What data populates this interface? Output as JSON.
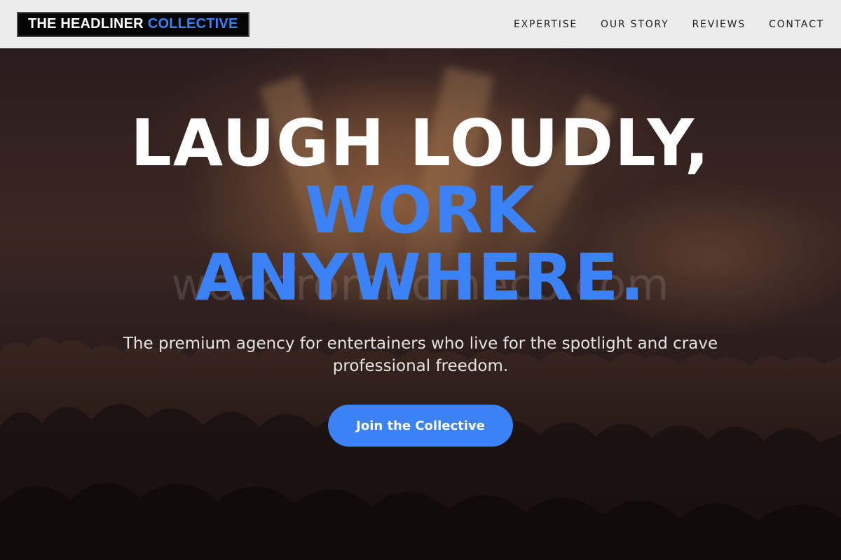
{
  "header": {
    "logo_primary": "THE HEADLINER",
    "logo_accent": "COLLECTIVE",
    "nav": [
      {
        "label": "EXPERTISE"
      },
      {
        "label": "OUR STORY"
      },
      {
        "label": "REVIEWS"
      },
      {
        "label": "CONTACT"
      }
    ]
  },
  "hero": {
    "headline_line1": "LAUGH LOUDLY,",
    "headline_line2": "WORK",
    "headline_line3": "ANYWHERE.",
    "subtitle": "The premium agency for entertainers who live for the spotlight and crave professional freedom.",
    "cta_label": "Join the Collective",
    "watermark": "workfromhomeco.com"
  },
  "colors": {
    "accent": "#3b82f6",
    "header_bg": "#ececec",
    "logo_bg": "#050505",
    "hero_text": "#ffffff"
  }
}
